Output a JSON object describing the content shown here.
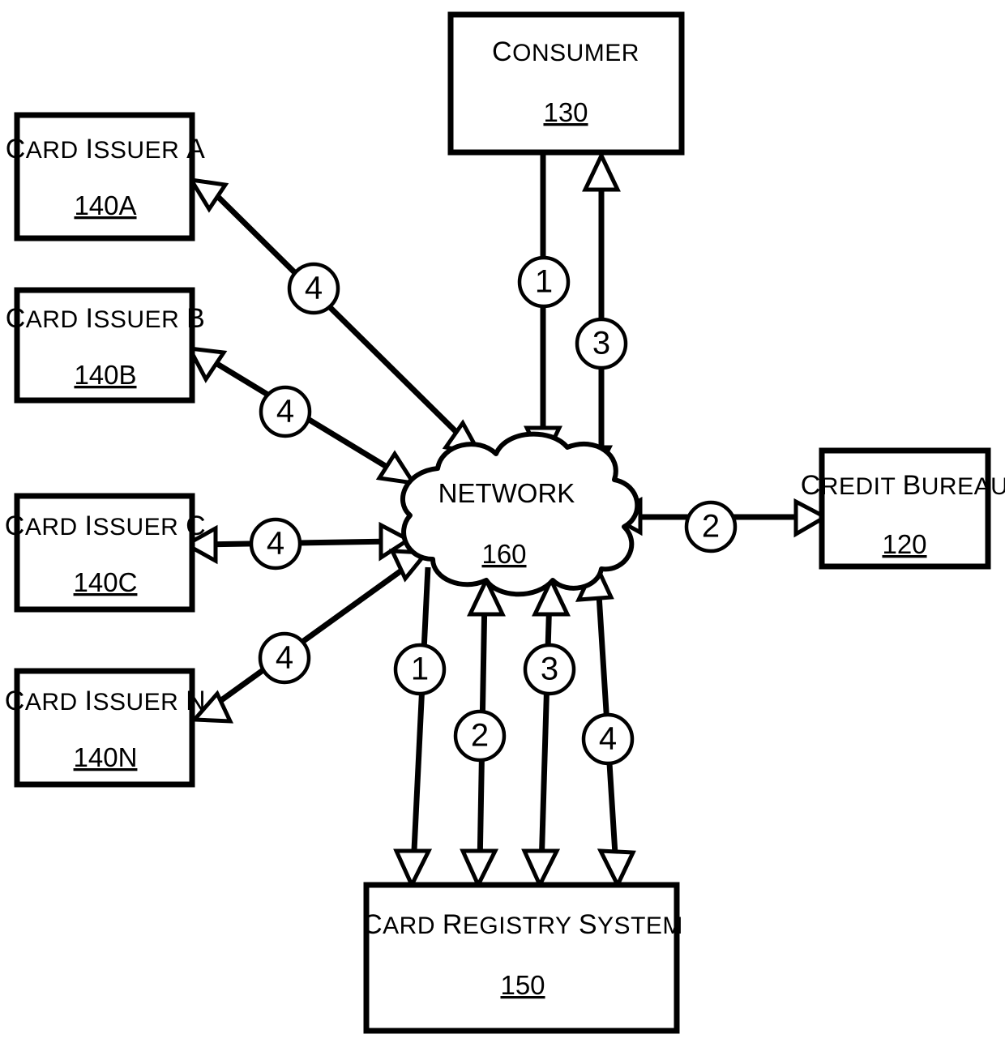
{
  "diagram": {
    "type": "patent-system-block-diagram",
    "background_color": "#ffffff",
    "line_color": "#000000",
    "nodes": {
      "consumer": {
        "title": "Consumer",
        "ref": "130"
      },
      "credit_bureau": {
        "title": "Credit Bureau",
        "ref": "120"
      },
      "card_registry_system": {
        "title": "Card Registry System",
        "ref": "150"
      },
      "network": {
        "title": "NETWORK",
        "ref": "160"
      },
      "card_issuer_a": {
        "title": "Card Issuer A",
        "ref": "140A"
      },
      "card_issuer_b": {
        "title": "Card Issuer B",
        "ref": "140B"
      },
      "card_issuer_c": {
        "title": "Card Issuer C",
        "ref": "140C"
      },
      "card_issuer_n": {
        "title": "Card Issuer N",
        "ref": "140N"
      }
    },
    "step_labels": {
      "issuer_a": "4",
      "issuer_b": "4",
      "issuer_c": "4",
      "issuer_n": "4",
      "consumer_down": "1",
      "consumer_up": "3",
      "credit_bureau": "2",
      "registry_1": "1",
      "registry_2": "2",
      "registry_3": "3",
      "registry_4": "4"
    }
  }
}
